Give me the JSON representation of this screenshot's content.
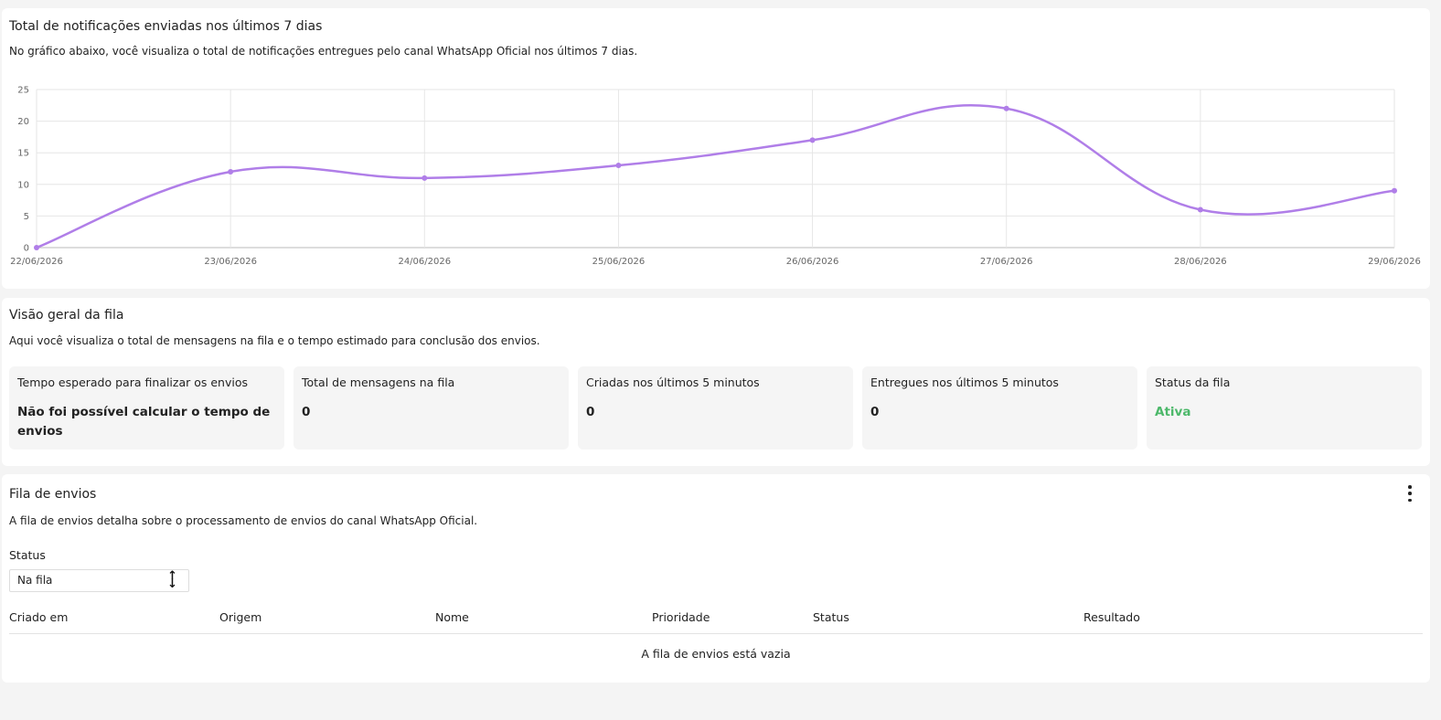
{
  "chart_section": {
    "title": "Total de notificações enviadas nos últimos 7 dias",
    "description": "No gráfico abaixo, você visualiza o total de notificações entregues pelo canal WhatsApp Oficial nos últimos 7 dias."
  },
  "chart_data": {
    "type": "line",
    "x": [
      "22/06/2026",
      "23/06/2026",
      "24/06/2026",
      "25/06/2026",
      "26/06/2026",
      "27/06/2026",
      "28/06/2026",
      "29/06/2026"
    ],
    "series": [
      {
        "values": [
          0,
          12,
          11,
          13,
          17,
          22,
          6,
          9
        ],
        "color": "#b07ee8"
      }
    ],
    "y_ticks": [
      0,
      5,
      10,
      15,
      20,
      25
    ],
    "ylim": [
      0,
      25
    ],
    "grid": true,
    "title": "",
    "xlabel": "",
    "ylabel": ""
  },
  "queue_overview": {
    "title": "Visão geral da fila",
    "description": "Aqui você visualiza o total de mensagens na fila e o tempo estimado para conclusão dos envios.",
    "stats": [
      {
        "label": "Tempo esperado para finalizar os envios",
        "value": "Não foi possível calcular o tempo de envios"
      },
      {
        "label": "Total de mensagens na fila",
        "value": "0"
      },
      {
        "label": "Criadas nos últimos 5 minutos",
        "value": "0"
      },
      {
        "label": "Entregues nos últimos 5 minutos",
        "value": "0"
      },
      {
        "label": "Status da fila",
        "value": "Ativa",
        "color": "#4cb86a"
      }
    ]
  },
  "send_queue": {
    "title": "Fila de envios",
    "description": "A fila de envios detalha sobre o processamento de envios do canal WhatsApp Oficial.",
    "status_filter": {
      "label": "Status",
      "selected": "Na fila"
    },
    "columns": [
      "Criado em",
      "Origem",
      "Nome",
      "Prioridade",
      "Status",
      "Resultado"
    ],
    "empty_message": "A fila de envios está vazia",
    "menu_icon": "kebab-menu-icon"
  }
}
